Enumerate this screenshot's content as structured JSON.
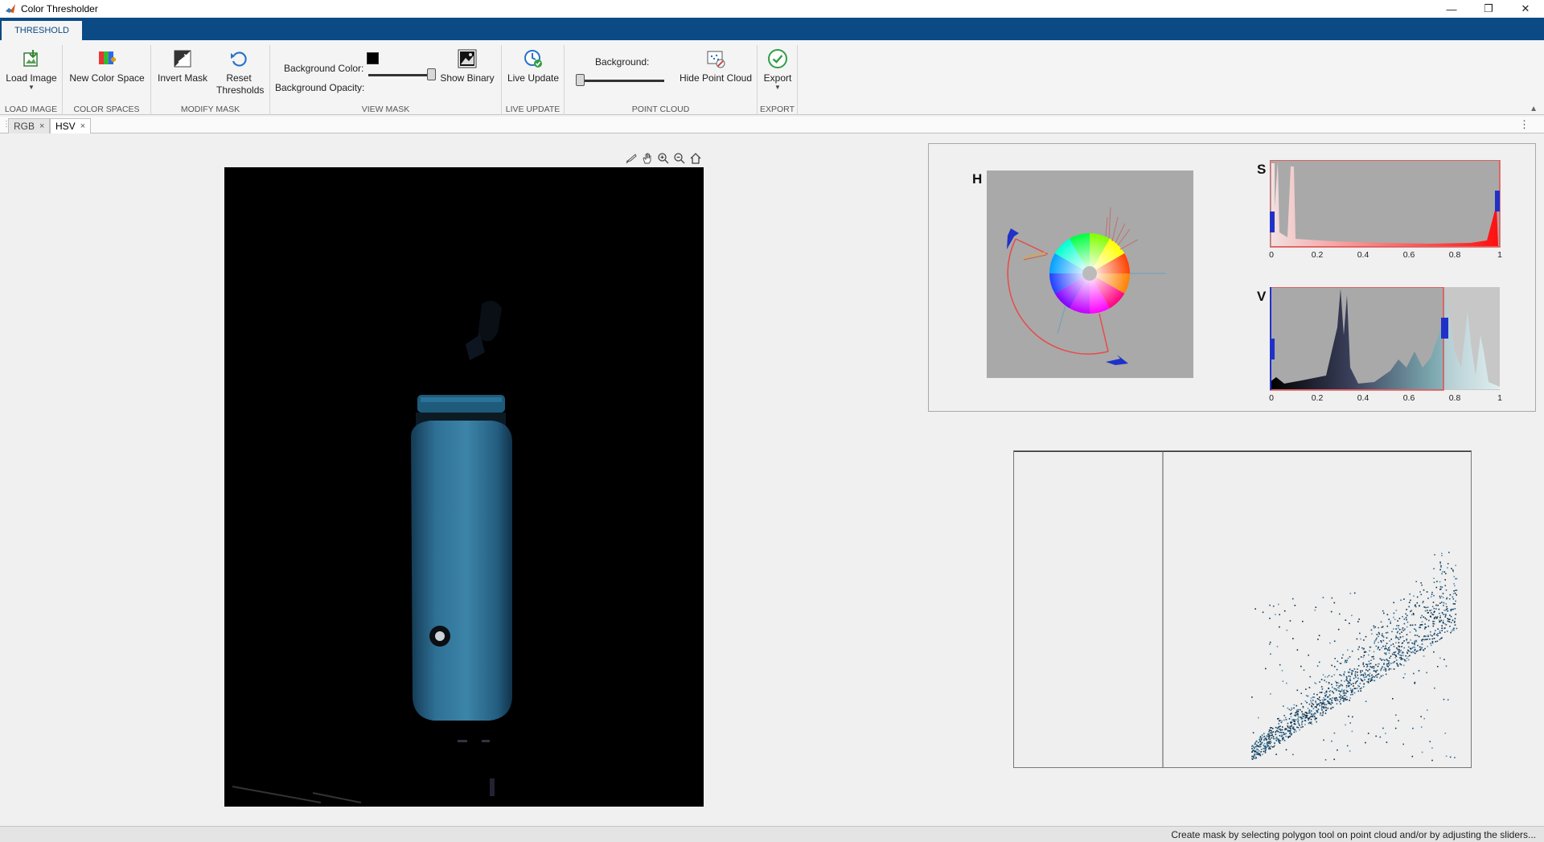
{
  "window": {
    "title": "Color Thresholder"
  },
  "window_controls": [
    "minimize-icon",
    "restore-icon",
    "close-icon"
  ],
  "ribbon_tab": "THRESHOLD",
  "groups": {
    "load_image": {
      "label": "LOAD IMAGE",
      "button": "Load Image"
    },
    "color_spaces": {
      "label": "COLOR SPACES",
      "button": "New Color Space"
    },
    "modify_mask": {
      "label": "MODIFY MASK",
      "invert": "Invert Mask",
      "reset": "Reset Thresholds"
    },
    "view_mask": {
      "label": "VIEW MASK",
      "bg_color": "Background Color:",
      "bg_opacity": "Background Opacity:",
      "show_binary": "Show Binary",
      "bg_color_value": "#000000",
      "opacity_level": 1.0
    },
    "live_update": {
      "label": "LIVE UPDATE",
      "button": "Live Update"
    },
    "point_cloud": {
      "label": "POINT CLOUD",
      "background": "Background:",
      "hide": "Hide Point Cloud",
      "bg_level": 0.0
    },
    "export": {
      "label": "EXPORT",
      "button": "Export"
    }
  },
  "doc_tabs": [
    {
      "label": "RGB",
      "close": "×"
    },
    {
      "label": "HSV",
      "close": "×"
    }
  ],
  "axes_toolbar": [
    "brush-icon",
    "pan-hand-icon",
    "zoom-in-icon",
    "zoom-out-icon",
    "home-icon"
  ],
  "histograms": {
    "h_label": "H",
    "s_label": "S",
    "v_label": "V",
    "ticks": [
      "0",
      "0.2",
      "0.4",
      "0.6",
      "0.8",
      "1"
    ],
    "s_range": [
      0.0,
      1.0
    ],
    "v_range": [
      0.0,
      0.76
    ]
  },
  "status": "Create mask by selecting polygon tool on point cloud and/or by adjusting the sliders..."
}
